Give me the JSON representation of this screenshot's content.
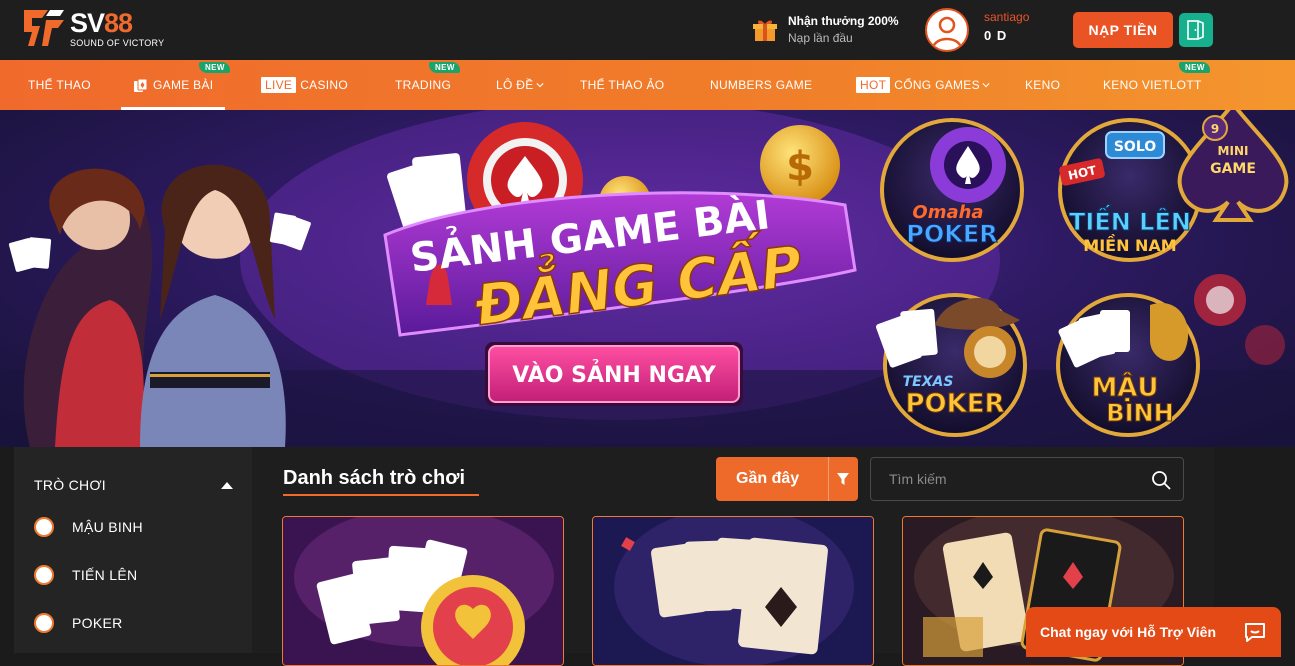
{
  "brand": {
    "name_white": "SV",
    "name_orange": "88",
    "tagline": "SOUND OF VICTORY"
  },
  "header": {
    "reward_title": "Nhận thưởng 200%",
    "reward_sub": "Nạp lần đầu",
    "username": "santiago",
    "balance": "0 D",
    "deposit_label": "NẠP TIỀN"
  },
  "nav": {
    "items": [
      {
        "label": "THỂ THAO"
      },
      {
        "label": "GAME BÀI",
        "badge": "NEW"
      },
      {
        "tag": "LIVE",
        "label": "CASINO"
      },
      {
        "label": "TRADING",
        "badge": "NEW"
      },
      {
        "label": "LÔ ĐỀ"
      },
      {
        "label": "THỂ THAO ẢO"
      },
      {
        "label": "NUMBERS GAME"
      },
      {
        "tag": "HOT",
        "label": "CỔNG GAMES"
      },
      {
        "label": "KENO"
      },
      {
        "label": "KENO VIETLOTT",
        "badge": "NEW"
      }
    ]
  },
  "banner": {
    "headline_1": "SẢNH GAME BÀI",
    "headline_2": "ĐẲNG CẤP",
    "cta": "VÀO SẢNH NGAY",
    "tiles": {
      "omaha_1": "Omaha",
      "omaha_2": "POKER",
      "solo": "SOLO",
      "hot": "HOT",
      "tienlen_1": "TIẾN LÊN",
      "tienlen_2": "MIỀN NAM",
      "mini_1": "MINI",
      "mini_2": "GAME",
      "mini_count": "9",
      "texas_1": "TEXAS",
      "texas_2": "POKER",
      "maubinh_1": "MẬU",
      "maubinh_2": "BINH"
    }
  },
  "sidebar": {
    "title": "TRÒ CHƠI",
    "filters": [
      {
        "label": "MẬU BINH"
      },
      {
        "label": "TIẾN LÊN"
      },
      {
        "label": "POKER"
      }
    ]
  },
  "main": {
    "title": "Danh sách trò chơi",
    "sort_label": "Gần đây",
    "search_placeholder": "Tìm kiếm"
  },
  "chat": {
    "label": "Chat ngay với Hỗ Trợ Viên"
  },
  "colors": {
    "accent": "#f06a2c",
    "green": "#16b08e",
    "dark": "#1e1e1e"
  }
}
